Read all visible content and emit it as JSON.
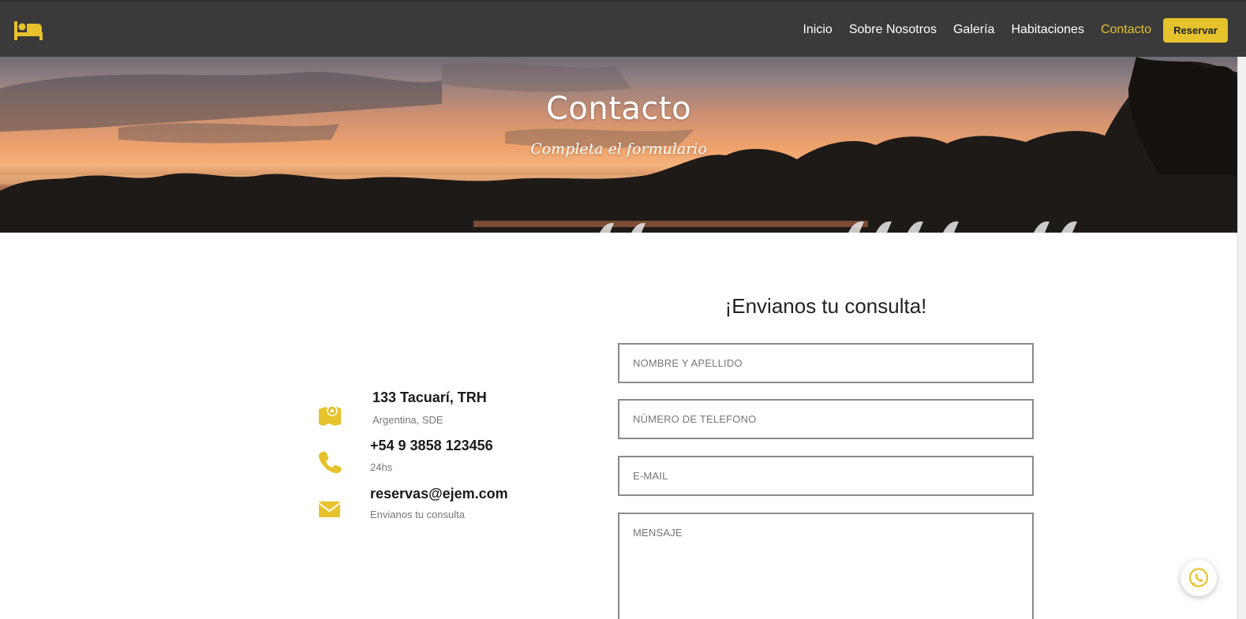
{
  "nav": {
    "logo_icon": "bed-icon",
    "links": [
      "Inicio",
      "Sobre Nosotros",
      "Galería",
      "Habitaciones",
      "Contacto"
    ],
    "active": "Contacto",
    "reserve_label": "Reservar"
  },
  "hero": {
    "title": "Contacto",
    "subtitle": "Completa el formulario"
  },
  "contact_info": [
    {
      "icon": "map-icon",
      "title": "133 Tacuarí, TRH",
      "subtitle": "Argentina, SDE"
    },
    {
      "icon": "phone-icon",
      "title": "+54 9 3858 123456",
      "subtitle": "24hs"
    },
    {
      "icon": "envelope-icon",
      "title": "reservas@ejem.com",
      "subtitle": "Envianos tu consulta"
    }
  ],
  "form": {
    "heading": "¡Envianos tu consulta!",
    "name_placeholder": "NOMBRE Y APELLIDO",
    "phone_placeholder": "NÚMERO DE TELEFONO",
    "email_placeholder": "E-MAIL",
    "message_placeholder": "MENSAJE"
  },
  "whatsapp_icon": "whatsapp-icon",
  "colors": {
    "accent": "#e6c22c",
    "navbar": "#3a3a3a",
    "text_dark": "#1a1a1a",
    "text_muted": "#777777"
  }
}
